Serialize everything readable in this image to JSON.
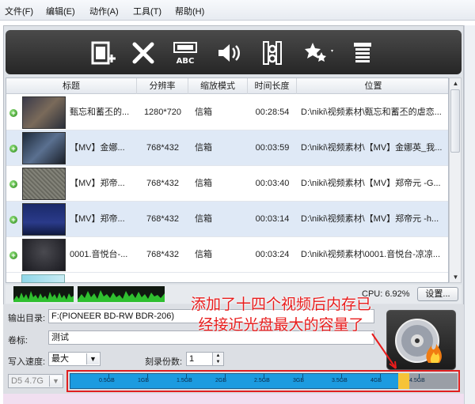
{
  "menu": [
    "文件(F)",
    "编辑(E)",
    "动作(A)",
    "工具(T)",
    "帮助(H)"
  ],
  "toolbar": {
    "icons": [
      "add-video-icon",
      "delete-icon",
      "subtitle-icon",
      "audio-icon",
      "edit-clip-icon",
      "effects-icon",
      "list-icon"
    ],
    "subtitle_text": "ABC"
  },
  "table": {
    "headers": [
      "标题",
      "分辨率",
      "缩放模式",
      "时间长度",
      "位置"
    ],
    "rows": [
      {
        "title": "甄忘和蓄丕的...",
        "resolution": "1280*720",
        "zoom": "信箱",
        "duration": "00:28:54",
        "location": "D:\\niki\\视频素材\\甄忘和蓄丕的虐恋..."
      },
      {
        "title": "【MV】金娜...",
        "resolution": "768*432",
        "zoom": "信箱",
        "duration": "00:03:59",
        "location": "D:\\niki\\视频素材\\【MV】金娜英_我..."
      },
      {
        "title": "【MV】郑帝...",
        "resolution": "768*432",
        "zoom": "信箱",
        "duration": "00:03:40",
        "location": "D:\\niki\\视频素材\\【MV】郑帝元 -G..."
      },
      {
        "title": "【MV】郑帝...",
        "resolution": "768*432",
        "zoom": "信箱",
        "duration": "00:03:14",
        "location": "D:\\niki\\视频素材\\【MV】郑帝元 -h..."
      },
      {
        "title": "0001.音悦台-...",
        "resolution": "768*432",
        "zoom": "信箱",
        "duration": "00:03:24",
        "location": "D:\\niki\\视频素材\\0001.音悦台-凉凉..."
      }
    ]
  },
  "status": {
    "cpu": "CPU: 6.92%",
    "settings_label": "设置..."
  },
  "settings": {
    "output_label": "输出目录:",
    "output_value": "F:(PIONEER BD-RW   BDR-206)",
    "volume_label": "卷标:",
    "volume_value": "测试",
    "speed_label": "写入速度:",
    "speed_value": "最大",
    "copies_label": "刻录份数:",
    "copies_value": "1",
    "disc_type": "D5 4.7G"
  },
  "capacity": {
    "ticks": [
      "0.5GB",
      "1GB",
      "1.5GB",
      "2GB",
      "2.5GB",
      "3GB",
      "3.5GB",
      "4GB",
      "4.5GB"
    ],
    "used_gb": 4.3,
    "total_gb": 4.7
  },
  "annotation": {
    "line1": "添加了十四个视频后内存已",
    "line2": "经接近光盘最大的容量了"
  },
  "colors": {
    "accent_blue": "#1c9be0",
    "used_yellow": "#f6c338",
    "annotation_red": "#e81c1c"
  }
}
